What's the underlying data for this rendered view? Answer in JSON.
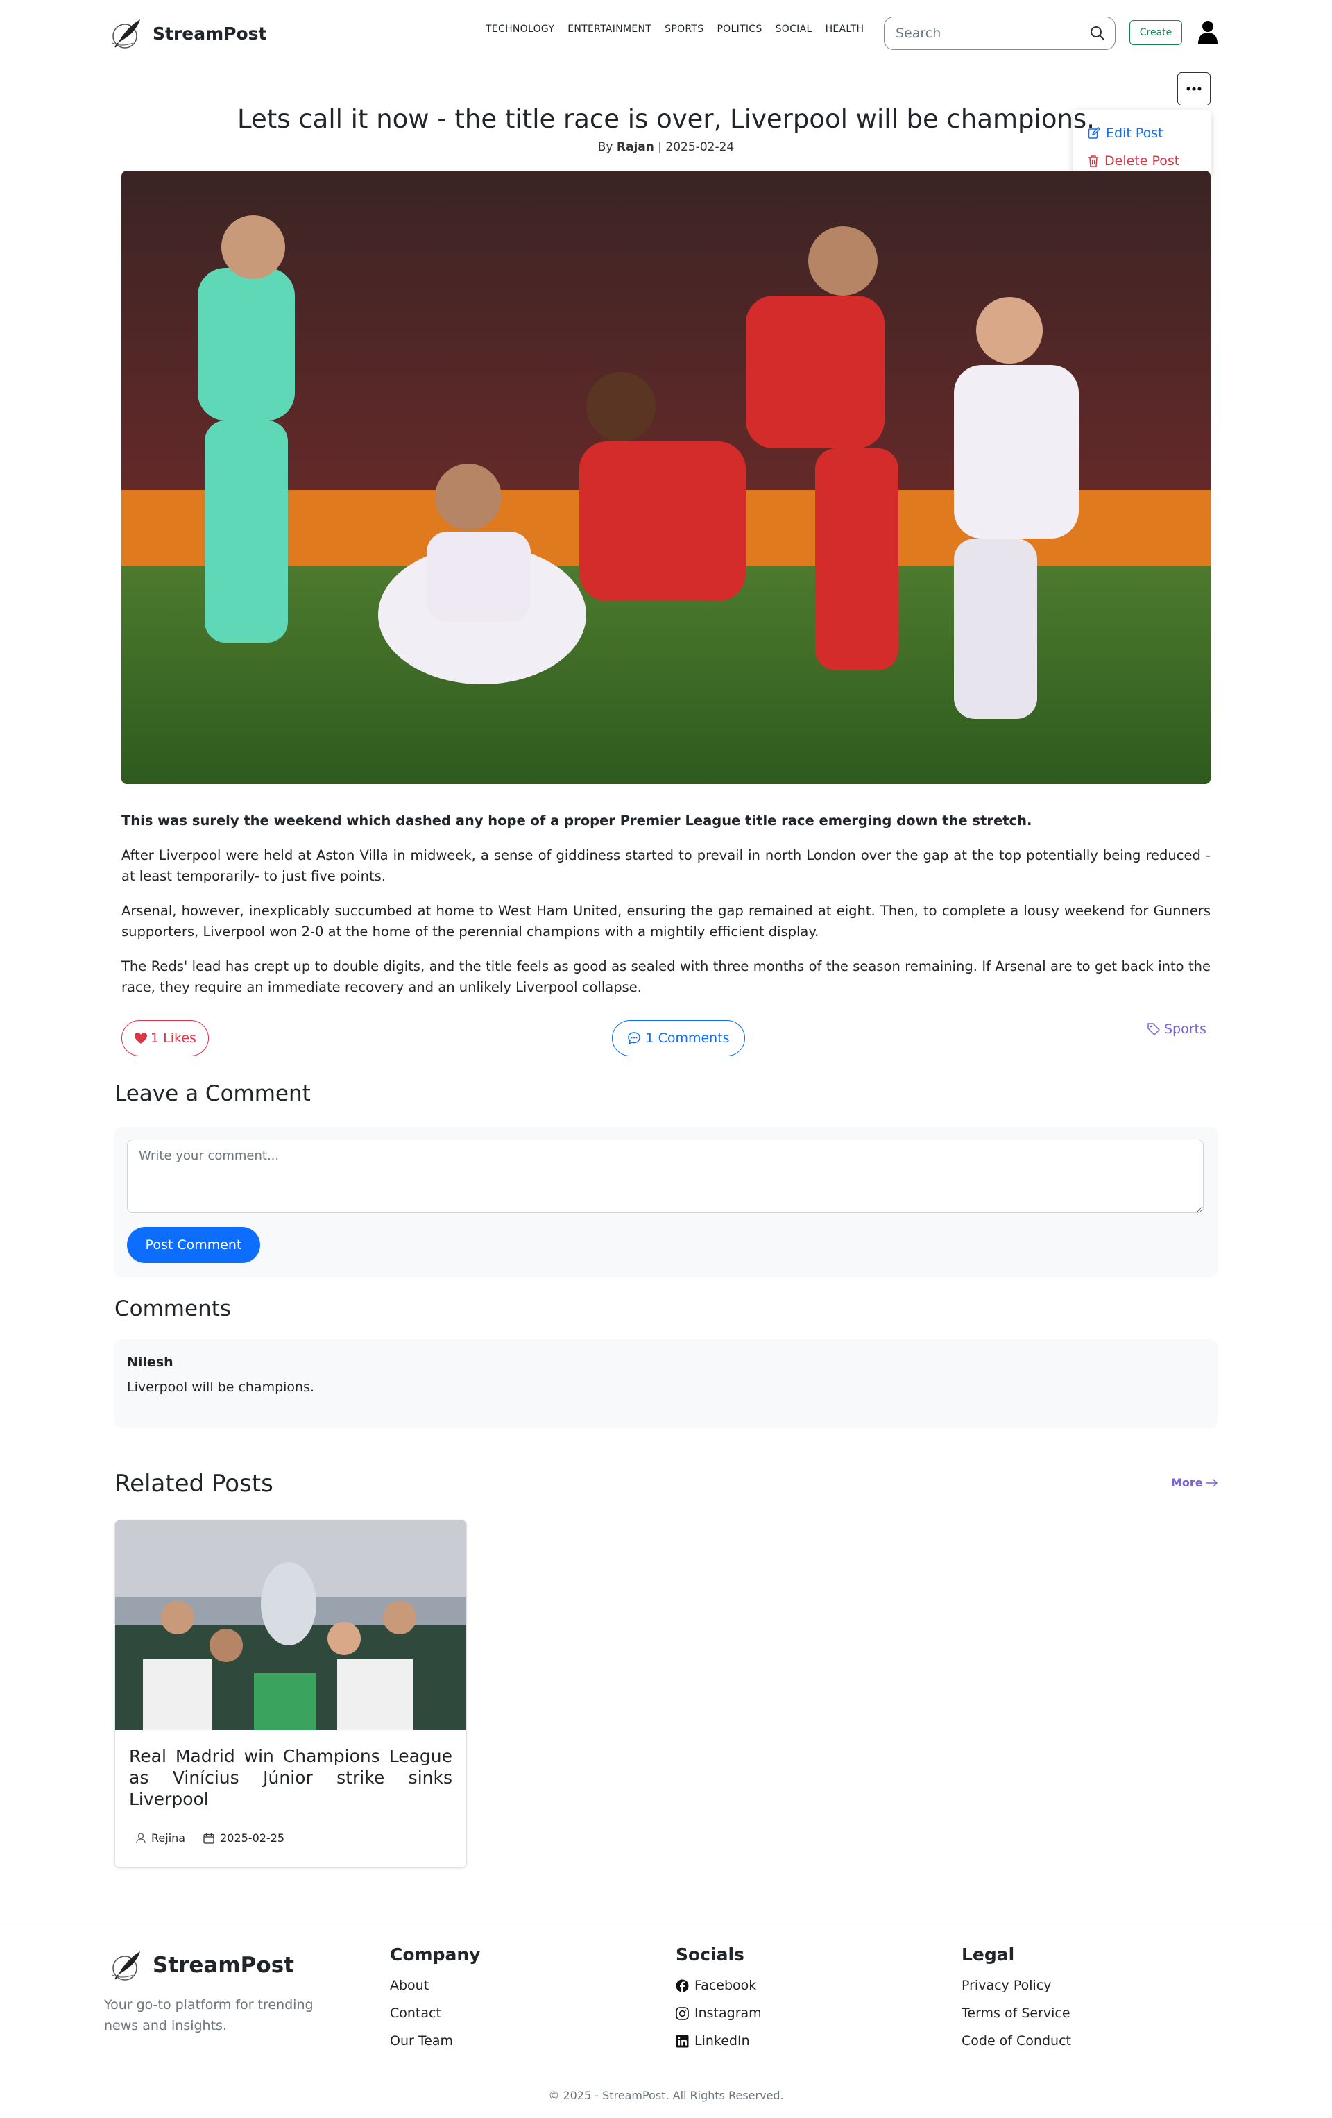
{
  "header": {
    "brand": "StreamPost",
    "nav": [
      "TECHNOLOGY",
      "ENTERTAINMENT",
      "SPORTS",
      "POLITICS",
      "SOCIAL",
      "HEALTH"
    ],
    "search_placeholder": "Search",
    "create_label": "Create"
  },
  "post_menu": {
    "edit_label": "Edit Post",
    "delete_label": "Delete Post"
  },
  "post": {
    "title": "Lets call it now - the title race is over, Liverpool will be champions.",
    "by_prefix": "By",
    "author": "Rajan",
    "separator": "|",
    "date": "2025-02-24",
    "paragraphs": [
      "This was surely the weekend which dashed any hope of a proper Premier League title race emerging down the stretch.",
      "After Liverpool were held at Aston Villa in midweek, a sense of giddiness started to prevail in north London over the gap at the top potentially being reduced - at least temporarily- to just five points.",
      "Arsenal, however, inexplicably succumbed at home to West Ham United, ensuring the gap remained at eight. Then, to complete a lousy weekend for Gunners supporters, Liverpool won 2-0 at the home of the perennial champions with a mightily efficient display.",
      "The Reds' lead has crept up to double digits, and the title feels as good as sealed with three months of the season remaining. If Arsenal are to get back into the race, they require an immediate recovery and an unlikely Liverpool collapse."
    ],
    "likes_label": "1 Likes",
    "comments_label": "1 Comments",
    "tag": "Sports"
  },
  "comment_form": {
    "heading": "Leave a Comment",
    "placeholder": "Write your comment...",
    "submit_label": "Post Comment"
  },
  "comments": {
    "heading": "Comments",
    "items": [
      {
        "author": "Nilesh",
        "text": "Liverpool will be champions."
      }
    ]
  },
  "related": {
    "heading": "Related Posts",
    "more_label": "More",
    "items": [
      {
        "title": "Real Madrid win Champions League as Vinícius Júnior strike sinks Liverpool",
        "author": "Rejina",
        "date": "2025-02-25"
      }
    ]
  },
  "footer": {
    "brand": "StreamPost",
    "tagline": "Your go-to platform for trending news and insights.",
    "company": {
      "heading": "Company",
      "links": [
        "About",
        "Contact",
        "Our Team"
      ]
    },
    "socials": {
      "heading": "Socials",
      "links": [
        "Facebook",
        "Instagram",
        "LinkedIn"
      ]
    },
    "legal": {
      "heading": "Legal",
      "links": [
        "Privacy Policy",
        "Terms of Service",
        "Code of Conduct"
      ]
    },
    "copyright": "© 2025 - StreamPost. All Rights Reserved."
  },
  "colors": {
    "primary": "#0d6efd",
    "danger": "#dc3545",
    "success": "#198754",
    "accent_purple": "#7b61d6"
  }
}
